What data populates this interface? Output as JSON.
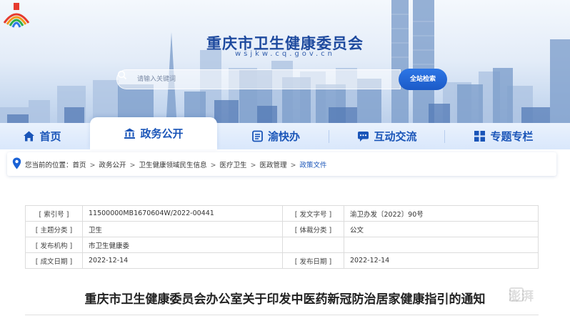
{
  "header": {
    "site_title": "重庆市卫生健康委员会",
    "site_domain": "wsjkw.cq.gov.cn",
    "search_placeholder": "请输入关键词",
    "search_button": "全站检索"
  },
  "nav": {
    "items": [
      {
        "label": "首页",
        "icon": "home-icon"
      },
      {
        "label": "政务公开",
        "icon": "government-icon",
        "active": true
      },
      {
        "label": "渝快办",
        "icon": "service-icon"
      },
      {
        "label": "互动交流",
        "icon": "chat-icon"
      },
      {
        "label": "专题专栏",
        "icon": "grid-icon"
      }
    ]
  },
  "breadcrumb": {
    "prefix": "您当前的位置：",
    "items": [
      "首页",
      "政务公开",
      "卫生健康领域民生信息",
      "医疗卫生",
      "医政管理",
      "政策文件"
    ],
    "separator": ">"
  },
  "meta": {
    "index_label": "[ 索引号 ]",
    "index_value": "11500000MB1670604W/2022-00441",
    "doc_no_label": "[ 发文字号 ]",
    "doc_no_value": "渝卫办发〔2022〕90号",
    "topic_label": "[ 主题分类 ]",
    "topic_value": "卫生",
    "genre_label": "[ 体裁分类 ]",
    "genre_value": "公文",
    "issuer_label": "[ 发布机构 ]",
    "issuer_value": "市卫生健康委",
    "created_label": "[ 成文日期 ]",
    "created_value": "2022-12-14",
    "published_label": "[ 发布日期 ]",
    "published_value": "2022-12-14"
  },
  "document": {
    "title": "重庆市卫生健康委员会办公室关于印发中医药新冠防治居家健康指引的通知"
  },
  "watermark": "澎湃",
  "colors": {
    "brand_blue": "#1a55b8",
    "search_button": "#1b5ac7"
  }
}
